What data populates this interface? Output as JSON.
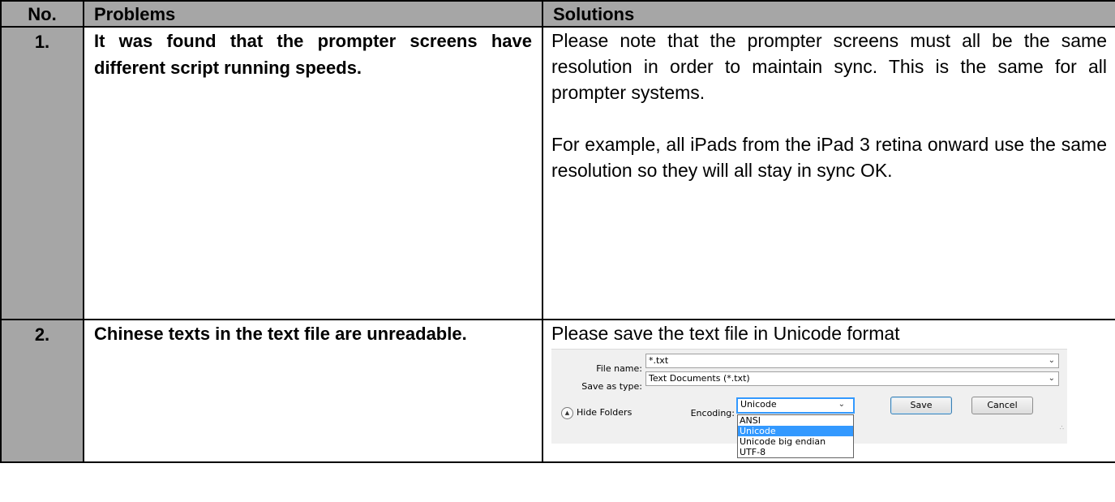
{
  "table": {
    "headers": {
      "no": "No.",
      "problems": "Problems",
      "solutions": "Solutions"
    },
    "rows": [
      {
        "no": "1.",
        "problem": "It was found that the prompter screens have different script running speeds.",
        "solution_p1": "Please note that the prompter screens must all be the same resolution in order to maintain sync. This is the same for all prompter systems.",
        "solution_p2": "For example, all iPads from the iPad 3 retina onward use the same resolution so they will all stay in sync OK."
      },
      {
        "no": "2.",
        "problem": "Chinese texts in the text file are unreadable.",
        "solution_p1": "Please save the text file in Unicode format"
      }
    ]
  },
  "save_dialog": {
    "file_name_label": "File name:",
    "file_name_value": "*.txt",
    "save_as_type_label": "Save as type:",
    "save_as_type_value": "Text Documents (*.txt)",
    "hide_folders_label": "Hide Folders",
    "encoding_label": "Encoding:",
    "encoding_value": "Unicode",
    "save_button": "Save",
    "cancel_button": "Cancel",
    "encoding_options": [
      "ANSI",
      "Unicode",
      "Unicode big endian",
      "UTF-8"
    ],
    "encoding_selected": "Unicode"
  }
}
